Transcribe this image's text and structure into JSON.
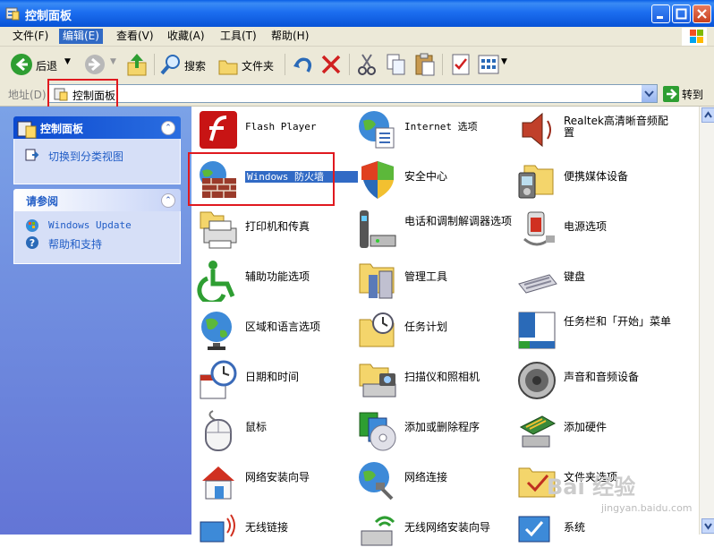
{
  "window": {
    "title": "控制面板",
    "colors": {
      "titlebar": "#0853d6",
      "selection": "#316ac5",
      "annotation": "#e0191f"
    }
  },
  "menu": [
    {
      "label": "文件(F)",
      "active": false
    },
    {
      "label": "编辑(E)",
      "active": true
    },
    {
      "label": "查看(V)",
      "active": false
    },
    {
      "label": "收藏(A)",
      "active": false
    },
    {
      "label": "工具(T)",
      "active": false
    },
    {
      "label": "帮助(H)",
      "active": false
    }
  ],
  "toolbar": {
    "back_label": "后退",
    "search_label": "搜索",
    "folders_label": "文件夹"
  },
  "address": {
    "label": "地址(D)",
    "value": "控制面板",
    "go_label": "转到"
  },
  "sidebar": {
    "panel1": {
      "title": "控制面板",
      "links": [
        {
          "label": "切换到分类视图",
          "icon": "switch-view-icon"
        }
      ]
    },
    "panel2": {
      "title": "请参阅",
      "links": [
        {
          "label": "Windows Update",
          "icon": "windows-update-icon"
        },
        {
          "label": "帮助和支持",
          "icon": "help-icon"
        }
      ]
    }
  },
  "items": [
    {
      "label": "Flash Player",
      "icon": "flash-player-icon"
    },
    {
      "label": "Internet 选项",
      "icon": "internet-options-icon"
    },
    {
      "label": "Realtek高清晰音频配置",
      "icon": "realtek-audio-icon"
    },
    {
      "label": "Windows 防火墙",
      "icon": "firewall-icon",
      "selected": true
    },
    {
      "label": "安全中心",
      "icon": "security-center-icon"
    },
    {
      "label": "便携媒体设备",
      "icon": "portable-media-icon"
    },
    {
      "label": "打印机和传真",
      "icon": "printer-icon"
    },
    {
      "label": "电话和调制解调器选项",
      "icon": "phone-modem-icon"
    },
    {
      "label": "电源选项",
      "icon": "power-options-icon"
    },
    {
      "label": "辅助功能选项",
      "icon": "accessibility-icon"
    },
    {
      "label": "管理工具",
      "icon": "admin-tools-icon"
    },
    {
      "label": "键盘",
      "icon": "keyboard-icon"
    },
    {
      "label": "区域和语言选项",
      "icon": "region-language-icon"
    },
    {
      "label": "任务计划",
      "icon": "scheduled-tasks-icon"
    },
    {
      "label": "任务栏和「开始」菜单",
      "icon": "taskbar-icon"
    },
    {
      "label": "日期和时间",
      "icon": "date-time-icon"
    },
    {
      "label": "扫描仪和照相机",
      "icon": "scanner-camera-icon"
    },
    {
      "label": "声音和音频设备",
      "icon": "sound-icon"
    },
    {
      "label": "鼠标",
      "icon": "mouse-icon"
    },
    {
      "label": "添加或删除程序",
      "icon": "add-remove-programs-icon"
    },
    {
      "label": "添加硬件",
      "icon": "add-hardware-icon"
    },
    {
      "label": "网络安装向导",
      "icon": "network-setup-icon"
    },
    {
      "label": "网络连接",
      "icon": "network-connections-icon"
    },
    {
      "label": "文件夹选项",
      "icon": "folder-options-icon"
    },
    {
      "label": "无线链接",
      "icon": "wireless-link-icon"
    },
    {
      "label": "无线网络安装向导",
      "icon": "wireless-network-icon"
    },
    {
      "label": "系统",
      "icon": "system-icon"
    }
  ],
  "watermark": {
    "text": "Bai 经验",
    "sub": "jingyan.baidu.com"
  }
}
